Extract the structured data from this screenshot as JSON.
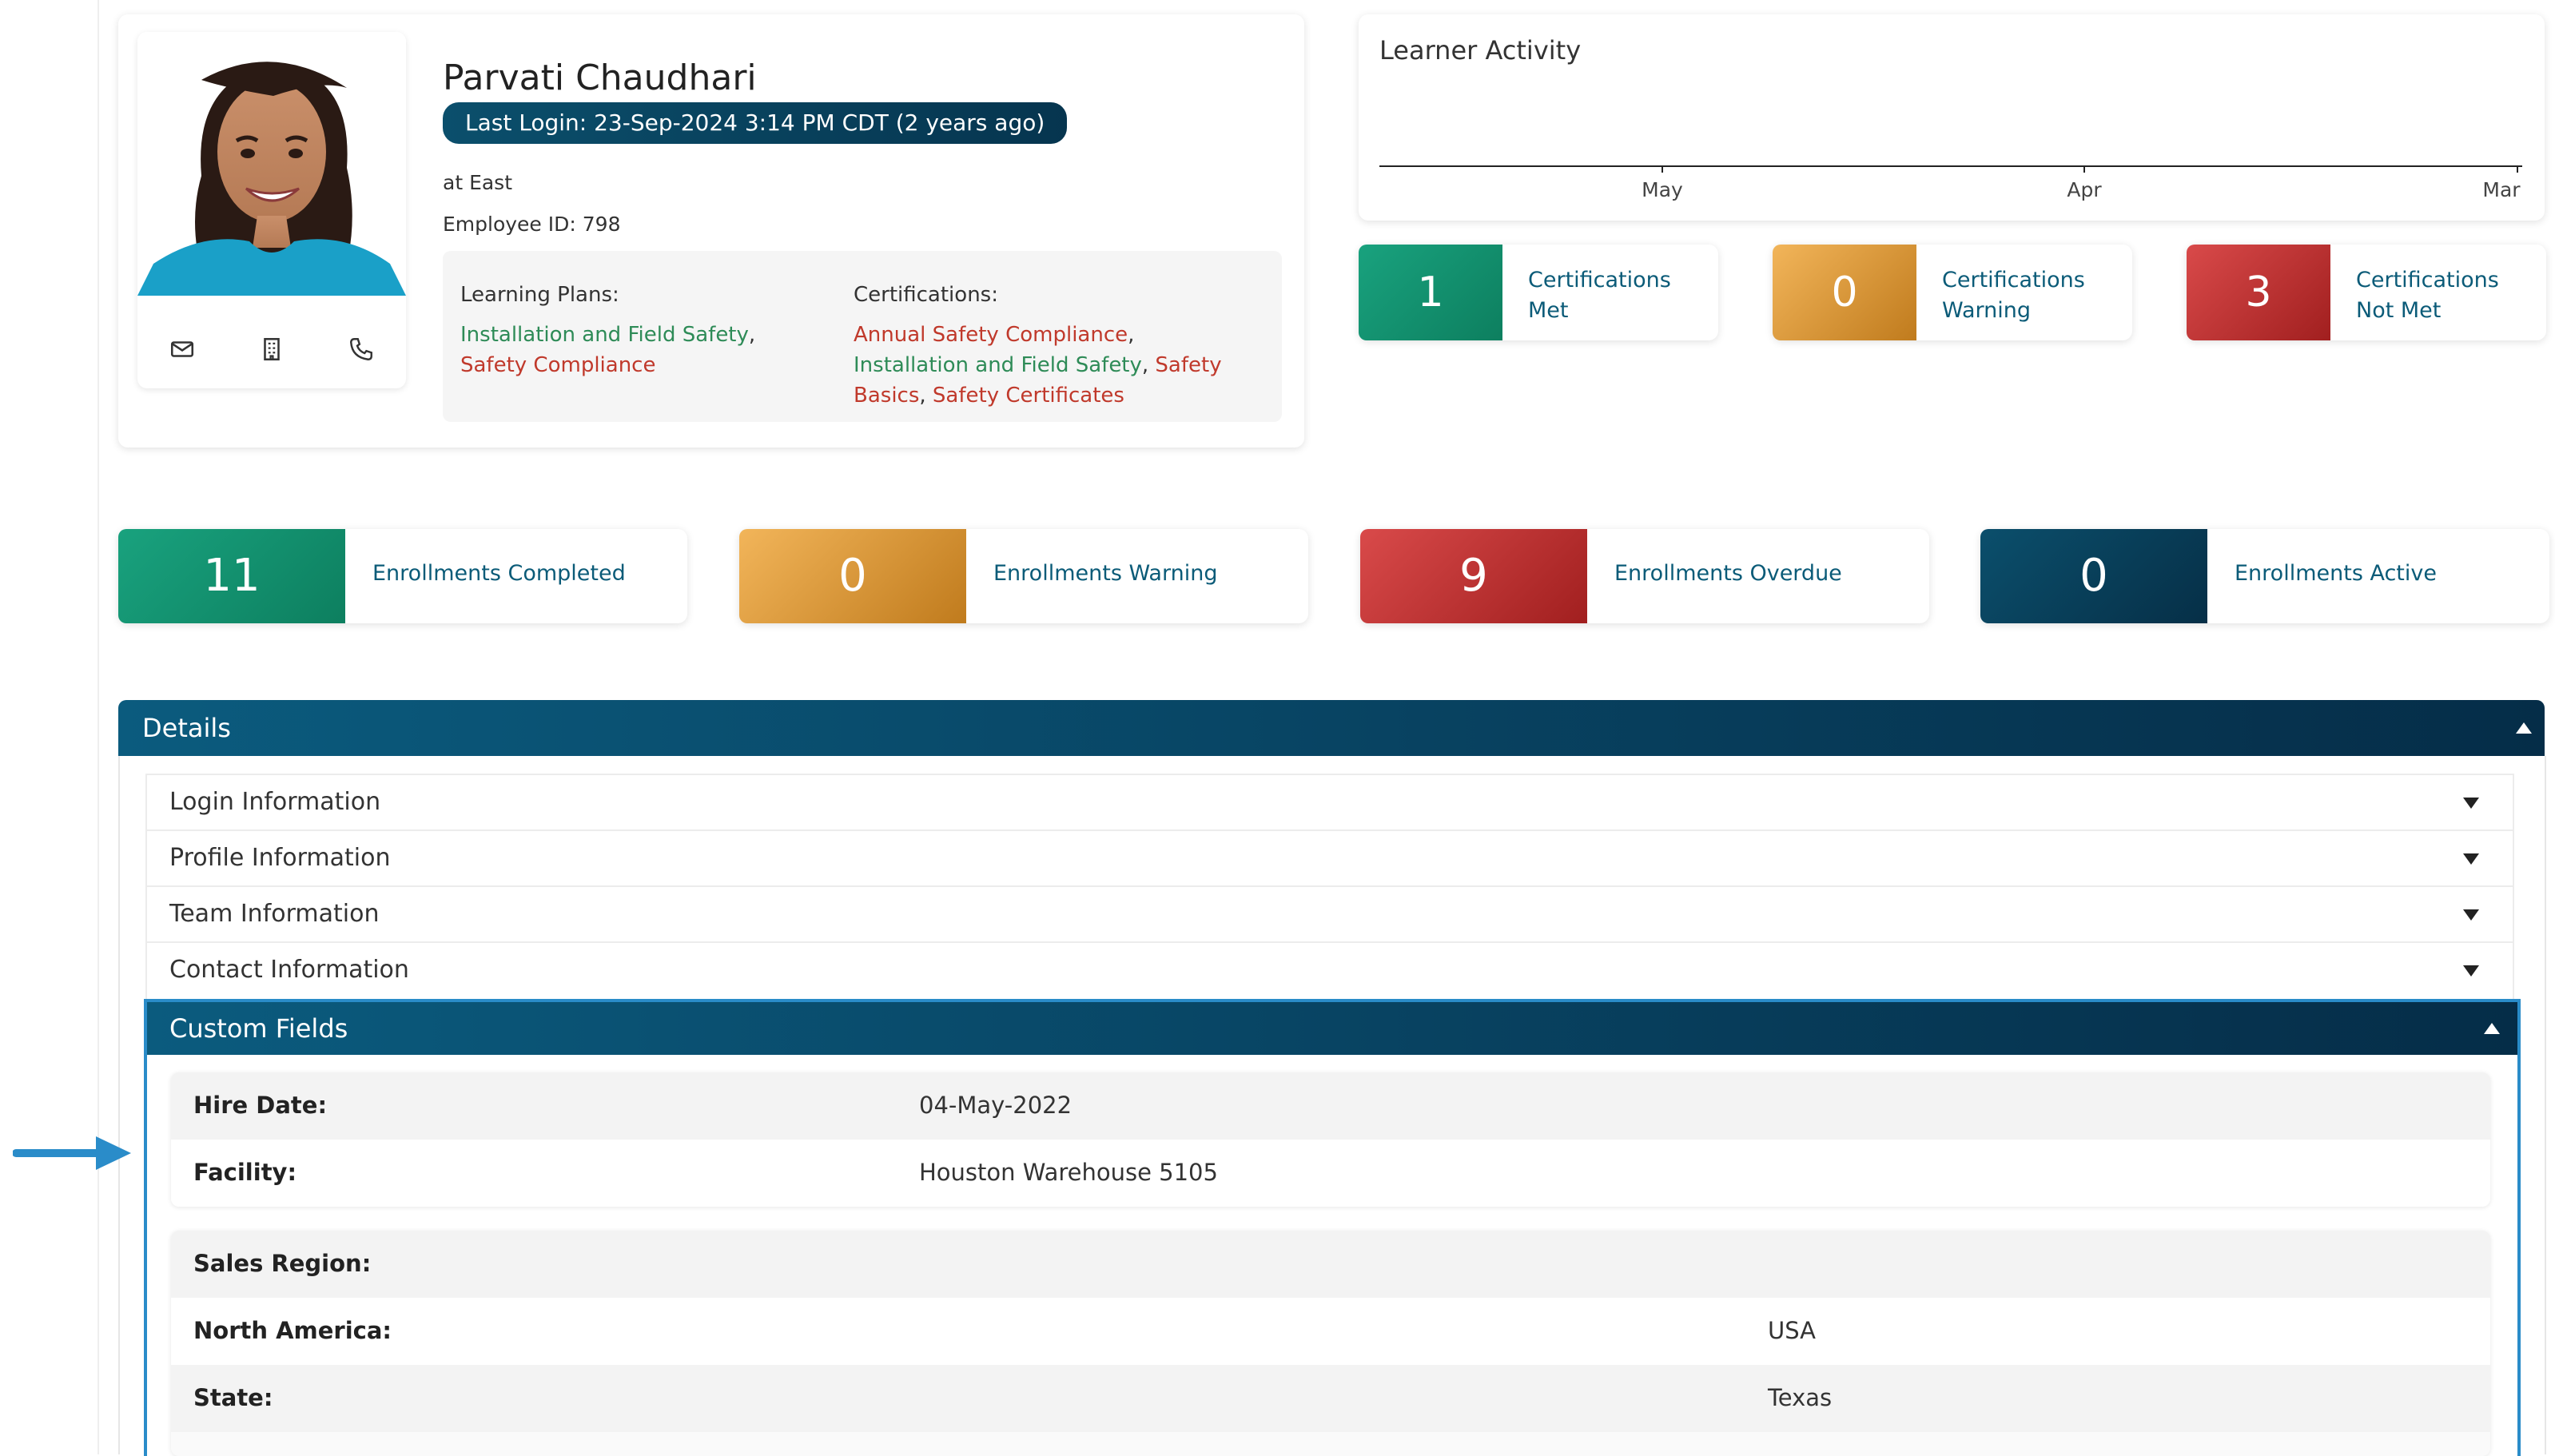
{
  "profile": {
    "name": "Parvati Chaudhari",
    "last_login": "Last Login: 23-Sep-2024 3:14 PM CDT (2 years ago)",
    "location": "at East",
    "employee_id": "Employee ID: 798",
    "contact_icons": [
      "envelope-icon",
      "building-icon",
      "phone-icon"
    ],
    "learning_plans_label": "Learning Plans:",
    "learning_plans": [
      {
        "text": "Installation and Field Safety",
        "status": "green"
      },
      {
        "text": "Safety Compliance",
        "status": "red"
      }
    ],
    "certifications_label": "Certifications:",
    "certifications": [
      {
        "text": "Annual Safety Compliance",
        "status": "red"
      },
      {
        "text": "Installation and Field Safety",
        "status": "green"
      },
      {
        "text": "Safety Basics",
        "status": "red"
      },
      {
        "text": "Safety Certificates",
        "status": "red"
      }
    ]
  },
  "activity": {
    "title": "Learner Activity",
    "axis_ticks": [
      "May",
      "Apr",
      "Mar"
    ]
  },
  "cert_stats": [
    {
      "value": "1",
      "label_line1": "Certifications",
      "label_line2": "Met",
      "color": "#19a27e"
    },
    {
      "value": "0",
      "label_line1": "Certifications",
      "label_line2": "Warning",
      "color": "#e4a445"
    },
    {
      "value": "3",
      "label_line1": "Certifications",
      "label_line2": "Not Met",
      "color": "#c93636"
    }
  ],
  "enrollment_stats": [
    {
      "value": "11",
      "label": "Enrollments Completed",
      "color": "#19a27e"
    },
    {
      "value": "0",
      "label": "Enrollments Warning",
      "color": "#e4a445"
    },
    {
      "value": "9",
      "label": "Enrollments Overdue",
      "color": "#c93636"
    },
    {
      "value": "0",
      "label": "Enrollments Active",
      "color": "#0b4f6c"
    }
  ],
  "details": {
    "title": "Details",
    "sections": [
      {
        "label": "Login Information"
      },
      {
        "label": "Profile Information"
      },
      {
        "label": "Team Information"
      },
      {
        "label": "Contact Information"
      }
    ],
    "custom_fields": {
      "title": "Custom Fields",
      "group1": [
        {
          "label": "Hire Date:",
          "value": "04-May-2022"
        },
        {
          "label": "Facility:",
          "value": "Houston Warehouse 5105"
        }
      ],
      "group2_title": "Sales Region:",
      "group2": [
        {
          "label": "North America:",
          "value": "USA"
        },
        {
          "label": "State:",
          "value": "Texas"
        }
      ]
    }
  },
  "colors": {
    "accent_navy": "#0b4f6c",
    "link_green": "#2e8b57",
    "link_red": "#c0392b",
    "highlight_border": "#2a8cc9",
    "arrow": "#2a8cc9"
  }
}
